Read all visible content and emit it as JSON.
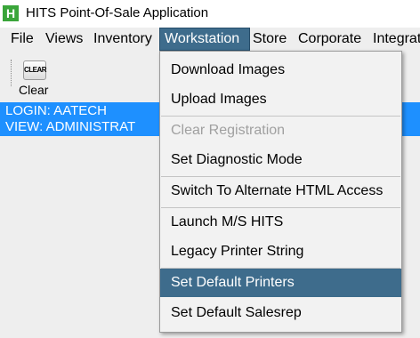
{
  "window": {
    "icon_letter": "H",
    "title": "HITS Point-Of-Sale Application"
  },
  "menubar": {
    "items": [
      "File",
      "Views",
      "Inventory",
      "Workstation",
      "Store",
      "Corporate",
      "Integrat"
    ],
    "active": "Workstation"
  },
  "toolbar": {
    "clear_icon_text": "CLEAR",
    "clear_label": "Clear"
  },
  "session": {
    "login": "LOGIN: AATECH",
    "view": "VIEW: ADMINISTRAT"
  },
  "workstation_menu": {
    "items": [
      {
        "label": "Download Images",
        "enabled": true
      },
      {
        "label": "Upload Images",
        "enabled": true
      },
      {
        "label": "Clear Registration",
        "enabled": false
      },
      {
        "label": "Set Diagnostic Mode",
        "enabled": true
      },
      {
        "label": "Switch To Alternate HTML Access",
        "enabled": true
      },
      {
        "label": "Launch M/S HITS",
        "enabled": true
      },
      {
        "label": "Legacy Printer String",
        "enabled": true
      },
      {
        "label": "Set Default Printers",
        "enabled": true,
        "highlighted": true
      },
      {
        "label": "Set Default Salesrep",
        "enabled": true
      }
    ]
  },
  "colors": {
    "selection": "#3e6c8c",
    "login_panel": "#1e90ff",
    "app_icon": "#3aa53a"
  }
}
